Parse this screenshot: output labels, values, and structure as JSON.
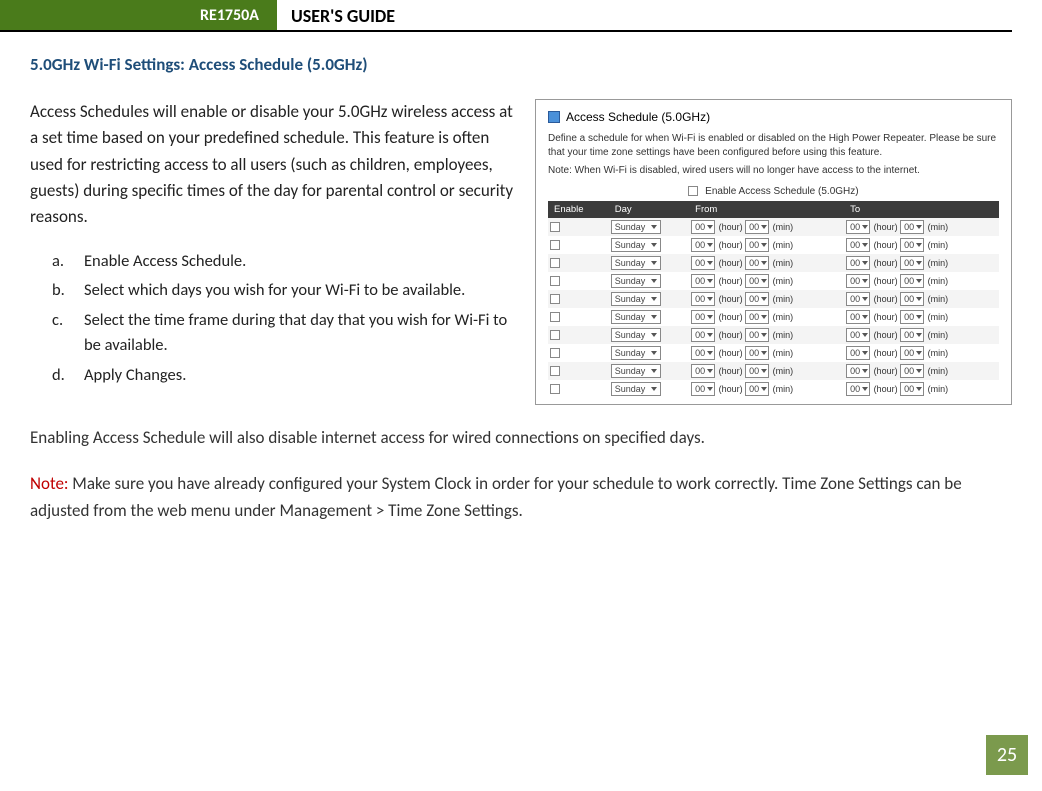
{
  "header": {
    "model": "RE1750A",
    "title": "USER'S GUIDE"
  },
  "section_title": "5.0GHz Wi-Fi Settings: Access Schedule (5.0GHz)",
  "intro": "Access Schedules will enable or disable your 5.0GHz wireless access at a set time based on your predefined schedule.  This feature is often used for restricting access to all users (such as children, employees, guests) during specific times of the day for parental control or security reasons.",
  "steps": [
    {
      "letter": "a.",
      "text": "Enable Access Schedule."
    },
    {
      "letter": "b.",
      "text": "Select which days you wish for your Wi-Fi to be available."
    },
    {
      "letter": "c.",
      "text": "Select the time frame during that day that you wish for Wi-Fi to be available."
    },
    {
      "letter": "d.",
      "text": "Apply Changes."
    }
  ],
  "after1": "Enabling Access Schedule will also disable internet access for wired connections on specified days.",
  "note_label": "Note:",
  "after2": "  Make sure you have already configured your System Clock in order for your schedule to work correctly. Time Zone Settings can be adjusted from the web menu under Management > Time Zone Settings.",
  "panel": {
    "title": "Access Schedule (5.0GHz)",
    "desc": "Define a schedule for when Wi-Fi is enabled or disabled on the High Power Repeater. Please be sure that your time zone settings have been configured before using this feature.",
    "note": "Note: When Wi-Fi is disabled, wired users will no longer have access to the internet.",
    "master_label": "Enable Access Schedule (5.0GHz)",
    "cols": {
      "enable": "Enable",
      "day": "Day",
      "from": "From",
      "to": "To"
    },
    "row_defaults": {
      "day": "Sunday",
      "hour": "00",
      "min": "00",
      "hour_label": "(hour)",
      "min_label": "(min)"
    },
    "row_count": 10
  },
  "page_number": "25"
}
